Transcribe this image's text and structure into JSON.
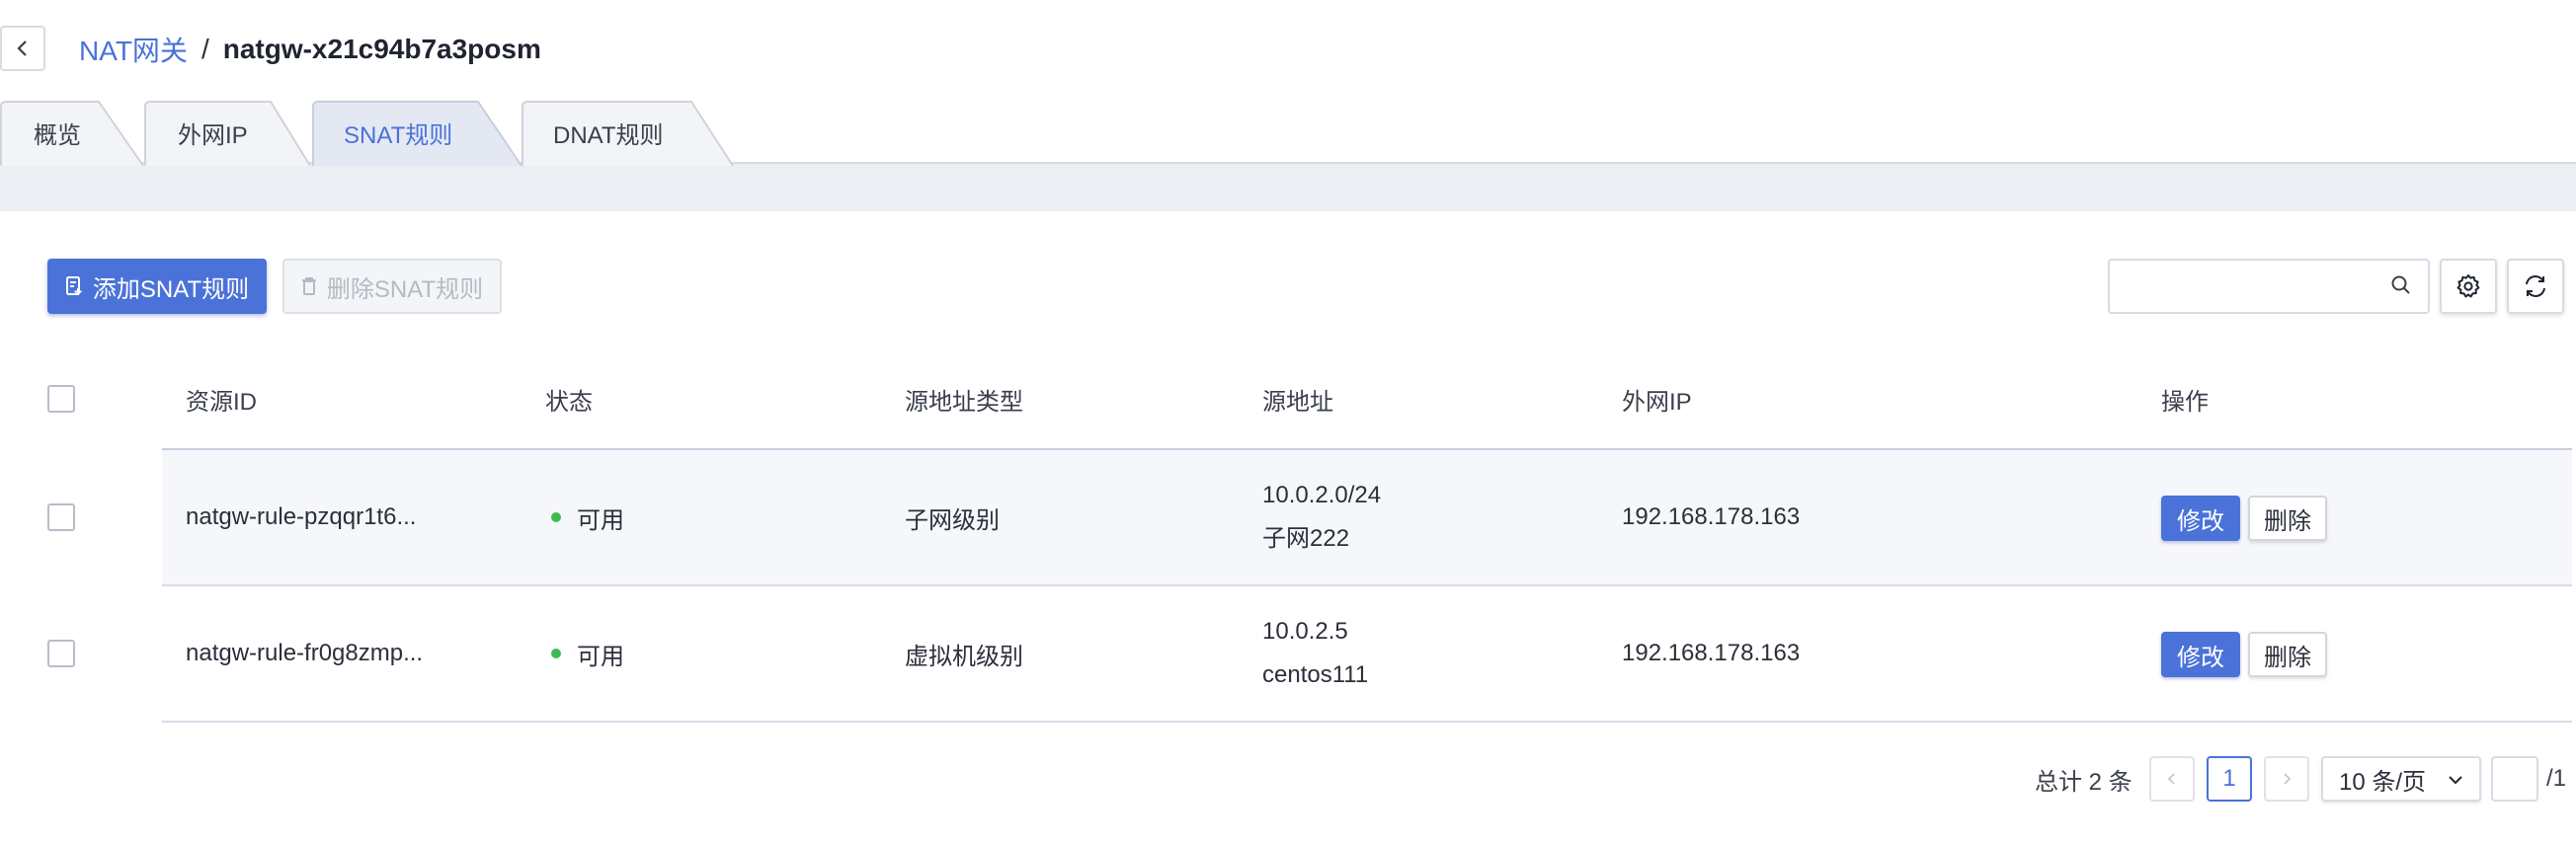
{
  "breadcrumb": {
    "parent": "NAT网关",
    "separator": "/",
    "current": "natgw-x21c94b7a3posm"
  },
  "tabs": [
    {
      "label": "概览",
      "active": false
    },
    {
      "label": "外网IP",
      "active": false
    },
    {
      "label": "SNAT规则",
      "active": true
    },
    {
      "label": "DNAT规则",
      "active": false
    }
  ],
  "toolbar": {
    "add_label": "添加SNAT规则",
    "delete_label": "删除SNAT规则",
    "search_placeholder": ""
  },
  "table": {
    "columns": [
      "资源ID",
      "状态",
      "源地址类型",
      "源地址",
      "外网IP",
      "操作"
    ],
    "rows": [
      {
        "id": "natgw-rule-pzqqr1t6...",
        "status": "可用",
        "source_type": "子网级别",
        "source_addr_1": "10.0.2.0/24",
        "source_addr_2": "子网222",
        "public_ip": "192.168.178.163",
        "edit": "修改",
        "delete": "删除"
      },
      {
        "id": "natgw-rule-fr0g8zmp...",
        "status": "可用",
        "source_type": "虚拟机级别",
        "source_addr_1": "10.0.2.5",
        "source_addr_2": "centos111",
        "public_ip": "192.168.178.163",
        "edit": "修改",
        "delete": "删除"
      }
    ]
  },
  "pagination": {
    "total_text": "总计 2 条",
    "current_page": "1",
    "page_size": "10 条/页",
    "jump_value": "",
    "total_pages": "/1"
  },
  "colors": {
    "primary": "#4a72d8",
    "status_available": "#3dbb53",
    "band": "#eceef4"
  }
}
